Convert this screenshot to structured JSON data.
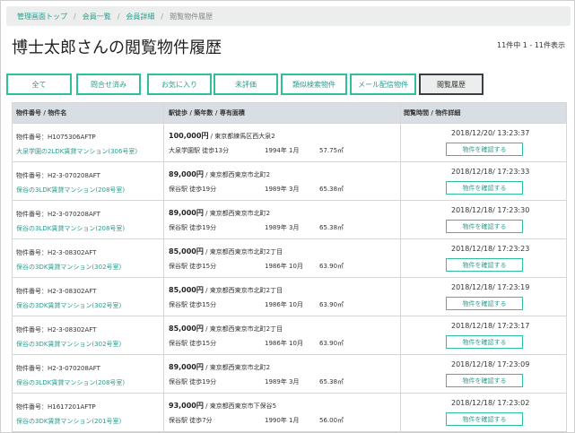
{
  "breadcrumb": [
    "管理画面トップ",
    "会員一覧",
    "会員詳細",
    "閲覧物件履歴"
  ],
  "page_title": "博士太郎さんの閲覧物件履歴",
  "result_count": "11件中 1 - 11件表示",
  "filters": [
    "全て",
    "問合せ済み",
    "お気に入り",
    "未評価",
    "類似検索物件",
    "メール配信物件",
    "閲覧履歴"
  ],
  "active_filter": "閲覧履歴",
  "columns": [
    "物件番号 / 物件名",
    "駅徒歩 / 築年数 / 専有面積",
    "閲覧時間 / 物件詳細"
  ],
  "rows": [
    {
      "id": "物件番号：H1075306AFTP",
      "name": "大泉学園の2LDK賃貸マンション(306号室)",
      "price": "100,000円",
      "address": "東京都練馬区西大泉2",
      "station": "大泉学園駅 徒歩13分",
      "built": "1994年 1月",
      "area": "57.75㎡",
      "time": "2018/12/20/ 13:23:37",
      "btn": "物件を確認する"
    },
    {
      "id": "物件番号：H2-3-070208AFT",
      "name": "保谷の3LDK賃貸マンション(208号室)",
      "price": "89,000円",
      "address": "東京都西東京市北町2",
      "station": "保谷駅 徒歩19分",
      "built": "1989年 3月",
      "area": "65.38㎡",
      "time": "2018/12/18/ 17:23:33",
      "btn": "物件を確認する"
    },
    {
      "id": "物件番号：H2-3-070208AFT",
      "name": "保谷の3LDK賃貸マンション(208号室)",
      "price": "89,000円",
      "address": "東京都西東京市北町2",
      "station": "保谷駅 徒歩19分",
      "built": "1989年 3月",
      "area": "65.38㎡",
      "time": "2018/12/18/ 17:23:30",
      "btn": "物件を確認する"
    },
    {
      "id": "物件番号：H2-3-08302AFT",
      "name": "保谷の3DK賃貸マンション(302号室)",
      "price": "85,000円",
      "address": "東京都西東京市北町2丁目",
      "station": "保谷駅 徒歩15分",
      "built": "1986年 10月",
      "area": "63.90㎡",
      "time": "2018/12/18/ 17:23:23",
      "btn": "物件を確認する"
    },
    {
      "id": "物件番号：H2-3-08302AFT",
      "name": "保谷の3DK賃貸マンション(302号室)",
      "price": "85,000円",
      "address": "東京都西東京市北町2丁目",
      "station": "保谷駅 徒歩15分",
      "built": "1986年 10月",
      "area": "63.90㎡",
      "time": "2018/12/18/ 17:23:19",
      "btn": "物件を確認する"
    },
    {
      "id": "物件番号：H2-3-08302AFT",
      "name": "保谷の3DK賃貸マンション(302号室)",
      "price": "85,000円",
      "address": "東京都西東京市北町2丁目",
      "station": "保谷駅 徒歩15分",
      "built": "1986年 10月",
      "area": "63.90㎡",
      "time": "2018/12/18/ 17:23:17",
      "btn": "物件を確認する"
    },
    {
      "id": "物件番号：H2-3-070208AFT",
      "name": "保谷の3LDK賃貸マンション(208号室)",
      "price": "89,000円",
      "address": "東京都西東京市北町2",
      "station": "保谷駅 徒歩19分",
      "built": "1989年 3月",
      "area": "65.38㎡",
      "time": "2018/12/18/ 17:23:09",
      "btn": "物件を確認する"
    },
    {
      "id": "物件番号：H1617201AFTP",
      "name": "保谷の3DK賃貸マンション(201号室)",
      "price": "93,000円",
      "address": "東京都西東京市下保谷5",
      "station": "保谷駅 徒歩7分",
      "built": "1990年 1月",
      "area": "56.00㎡",
      "time": "2018/12/18/ 17:23:02",
      "btn": "物件を確認する"
    }
  ],
  "colors": {
    "accent": "#2fbf9a",
    "link": "#2a9d8f",
    "header_bg": "#d8dee3",
    "breadcrumb_bg": "#eceeee"
  }
}
